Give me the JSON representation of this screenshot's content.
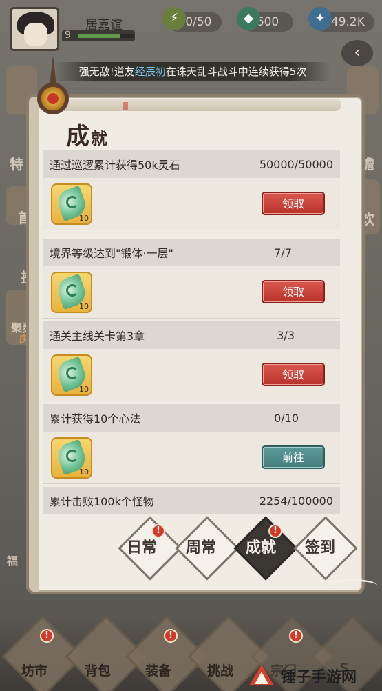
{
  "player": {
    "name": "居嘉谊",
    "level": "9",
    "exp_fraction": 0.75
  },
  "resources": [
    {
      "icon": "lightning-icon",
      "value": "70/50"
    },
    {
      "icon": "jade-icon",
      "value": "600"
    },
    {
      "icon": "spirit-stone-icon",
      "value": "149.2K"
    }
  ],
  "announcement": {
    "prefix": "强无敌!道友",
    "highlight": "经辰初",
    "suffix": "在诛天乱斗战斗中连续获得5次"
  },
  "background_labels": {
    "left_1": "特",
    "left_2": "首",
    "left_3": "投",
    "left_4": "聚灵",
    "left_5": "庆",
    "left_6": "福",
    "right_1": "瞻",
    "right_2": "欢"
  },
  "panel": {
    "title_1": "成",
    "title_2": "就"
  },
  "achievements": [
    {
      "task": "通过巡逻累计获得50k灵石",
      "progress": "50000/50000",
      "reward_qty": "10",
      "button": "领取",
      "state": "claim"
    },
    {
      "task": "境界等级达到\"锻体·一层\"",
      "progress": "7/7",
      "reward_qty": "10",
      "button": "领取",
      "state": "claim"
    },
    {
      "task": "通关主线关卡第3章",
      "progress": "3/3",
      "reward_qty": "10",
      "button": "领取",
      "state": "claim"
    },
    {
      "task": "累计获得10个心法",
      "progress": "0/10",
      "reward_qty": "10",
      "button": "前往",
      "state": "goto"
    },
    {
      "task": "累计击败100k个怪物",
      "progress": "2254/100000"
    }
  ],
  "tabs": [
    {
      "label": "日常",
      "badge": "!",
      "active": false
    },
    {
      "label": "周常",
      "active": false
    },
    {
      "label": "成就",
      "badge": "!",
      "active": true
    },
    {
      "label": "签到",
      "active": false
    }
  ],
  "bottom_nav": [
    {
      "label": "坊市",
      "badge": "!"
    },
    {
      "label": "背包"
    },
    {
      "label": "装备",
      "badge": "!"
    },
    {
      "label": "挑战"
    },
    {
      "label": "宗门",
      "badge": "!"
    },
    {
      "label": "S"
    }
  ],
  "watermark": "锤子手游网"
}
